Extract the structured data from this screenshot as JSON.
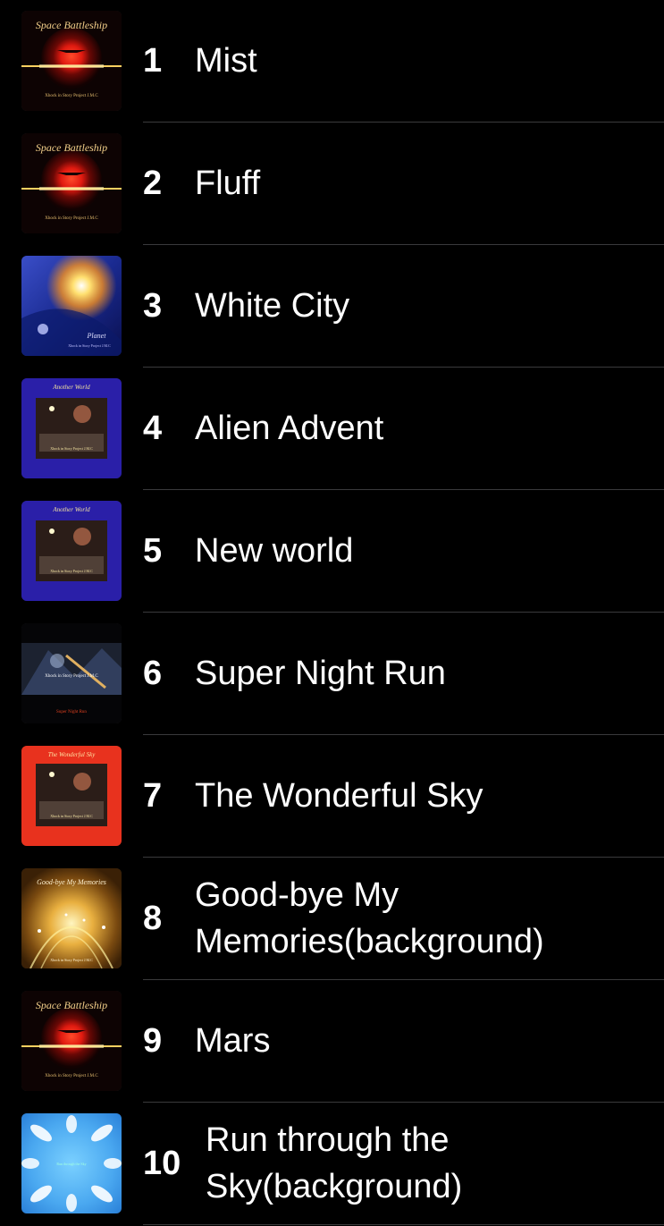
{
  "tracks": [
    {
      "number": "1",
      "title": "Mist",
      "art": "space-battleship",
      "art_text": "Space Battleship",
      "art_sub": "Xhock in Story Project J.M.C"
    },
    {
      "number": "2",
      "title": "Fluff",
      "art": "space-battleship",
      "art_text": "Space Battleship",
      "art_sub": "Xhock in Story Project J.M.C"
    },
    {
      "number": "3",
      "title": "White City",
      "art": "planet",
      "art_text": "Planet",
      "art_sub": "Xhock in Story Project J.M.C"
    },
    {
      "number": "4",
      "title": "Alien Advent",
      "art": "another-world",
      "art_text": "Another World",
      "art_sub": "Xhock in Story Project J.M.C"
    },
    {
      "number": "5",
      "title": "New world",
      "art": "another-world",
      "art_text": "Another World",
      "art_sub": "Xhock in Story Project J.M.C"
    },
    {
      "number": "6",
      "title": "Super Night Run",
      "art": "super-night-run",
      "art_text": "Xhock in Story Project J.M.C",
      "art_sub": "Super Night Run"
    },
    {
      "number": "7",
      "title": "The Wonderful Sky",
      "art": "wonderful-sky",
      "art_text": "The Wonderful Sky",
      "art_sub": "Xhock in Story Project J.M.C"
    },
    {
      "number": "8",
      "title": "Good-bye My Memories(background)",
      "art": "good-bye",
      "art_text": "Good-bye My Memories",
      "art_sub": "Xhock in Story Project J.M.C"
    },
    {
      "number": "9",
      "title": "Mars",
      "art": "space-battleship",
      "art_text": "Space Battleship",
      "art_sub": "Xhock in Story Project J.M.C"
    },
    {
      "number": "10",
      "title": "Run through the Sky(background)",
      "art": "run-sky",
      "art_text": "Run through the Sky",
      "art_sub": ""
    }
  ],
  "colors": {
    "background": "#000000",
    "separator": "#3a3a3c",
    "text": "#ffffff"
  }
}
